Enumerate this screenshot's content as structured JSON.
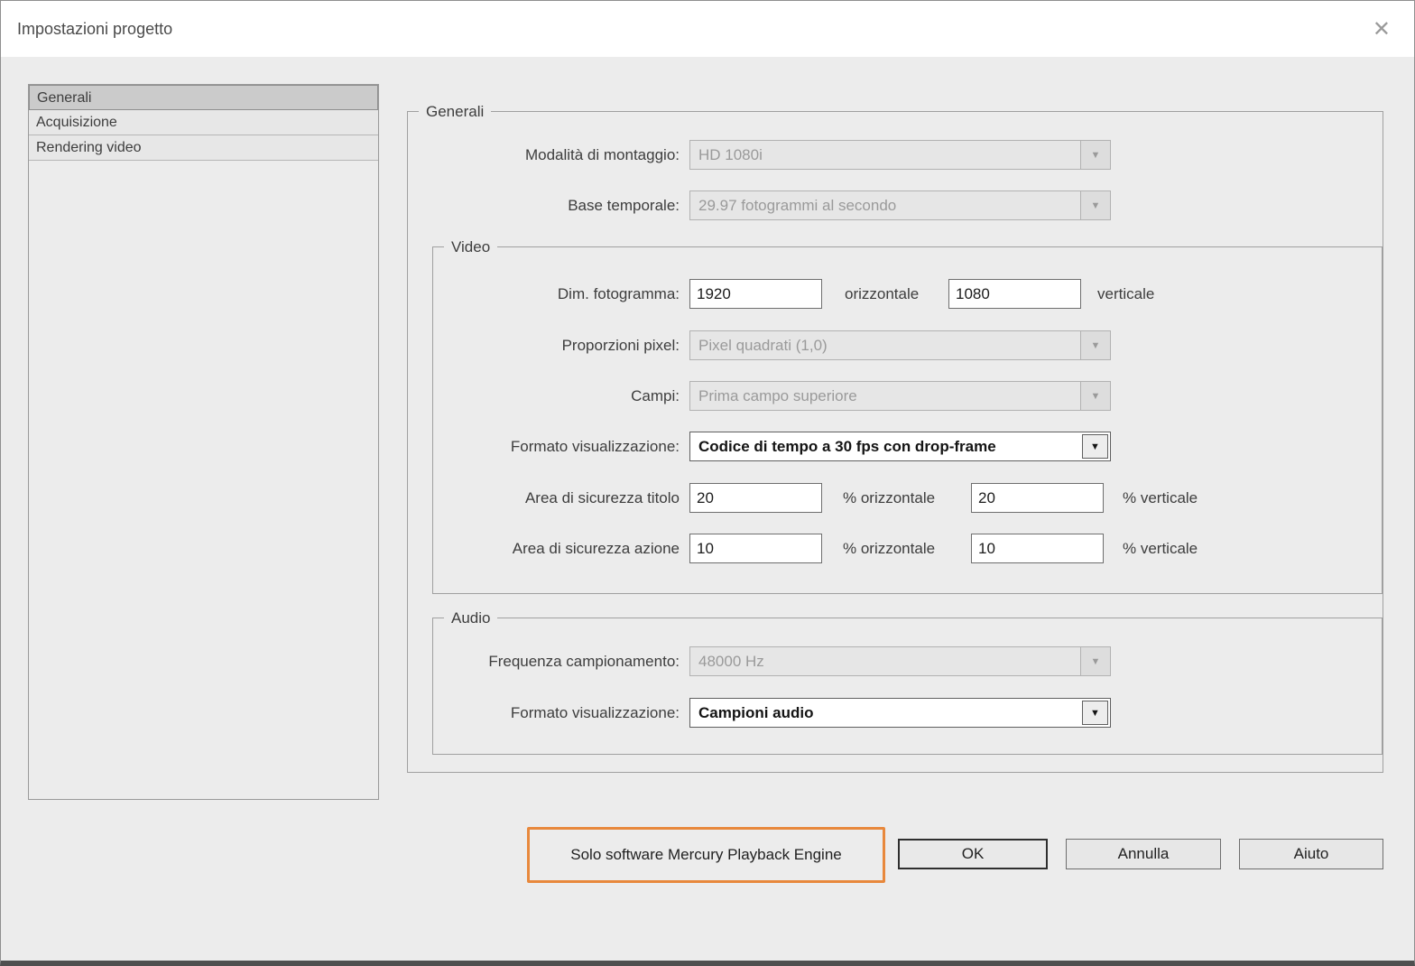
{
  "window": {
    "title": "Impostazioni progetto",
    "close_glyph": "✕"
  },
  "sidebar": {
    "items": [
      {
        "label": "Generali",
        "selected": true
      },
      {
        "label": "Acquisizione",
        "selected": false
      },
      {
        "label": "Rendering video",
        "selected": false
      }
    ]
  },
  "generali": {
    "legend": "Generali",
    "modalita": {
      "label": "Modalità di montaggio:",
      "value": "HD 1080i"
    },
    "base": {
      "label": "Base temporale:",
      "value": "29.97 fotogrammi al secondo"
    }
  },
  "video": {
    "legend": "Video",
    "dim": {
      "label": "Dim. fotogramma:",
      "h_value": "1920",
      "h_suffix": "orizzontale",
      "v_value": "1080",
      "v_suffix": "verticale"
    },
    "proporzioni": {
      "label": "Proporzioni pixel:",
      "value": "Pixel quadrati (1,0)"
    },
    "campi": {
      "label": "Campi:",
      "value": "Prima campo superiore"
    },
    "formato": {
      "label": "Formato visualizzazione:",
      "value": "Codice di tempo a 30 fps con drop-frame"
    },
    "titolo": {
      "label": "Area di sicurezza titolo",
      "h_value": "20",
      "h_suffix": "% orizzontale",
      "v_value": "20",
      "v_suffix": "% verticale"
    },
    "azione": {
      "label": "Area di sicurezza azione",
      "h_value": "10",
      "h_suffix": "% orizzontale",
      "v_value": "10",
      "v_suffix": "% verticale"
    }
  },
  "audio": {
    "legend": "Audio",
    "frequenza": {
      "label": "Frequenza campionamento:",
      "value": "48000 Hz"
    },
    "formato": {
      "label": "Formato visualizzazione:",
      "value": "Campioni audio"
    }
  },
  "footer": {
    "engine_text": "Solo software Mercury Playback Engine",
    "ok_label": "OK",
    "annulla_label": "Annulla",
    "aiuto_label": "Aiuto"
  },
  "icons": {
    "dropdown_arrow": "▼"
  },
  "colors": {
    "annotation_orange": "#e8883c"
  }
}
